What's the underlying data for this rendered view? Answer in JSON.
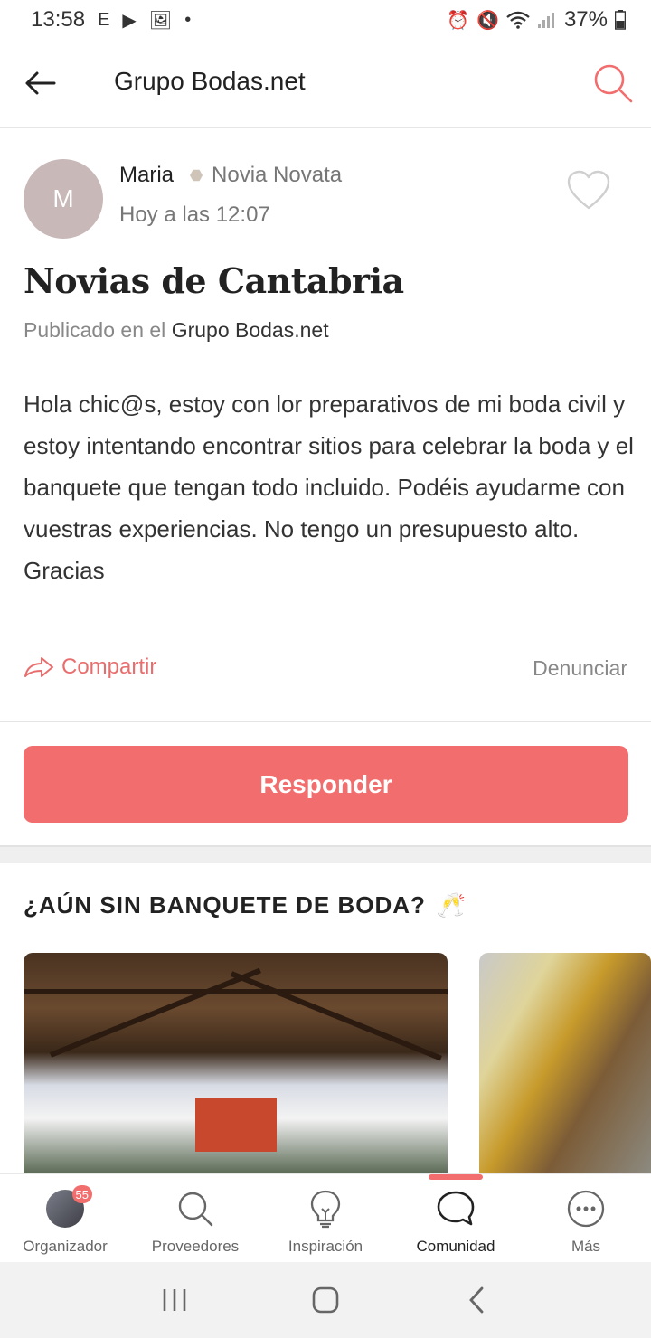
{
  "status_bar": {
    "time": "13:58",
    "left_icons": [
      "E",
      "▶",
      "🖼",
      "•"
    ],
    "battery": "37%"
  },
  "header": {
    "title": "Grupo Bodas.net"
  },
  "post": {
    "avatar_initial": "M",
    "author": "Maria",
    "rank": "Novia Novata",
    "time": "Hoy a las 12:07",
    "title": "Novias de Cantabria",
    "published_prefix": "Publicado en el",
    "published_group": "Grupo Bodas.net",
    "body": "Hola chic@s, estoy con lor preparativos de mi boda civil y estoy intentando encontrar sitios para celebrar la boda y el banquete que tengan todo incluido. Podéis ayudarme con vuestras experiencias. No tengo un presupuesto alto. Gracias",
    "share_label": "Compartir",
    "report_label": "Denunciar"
  },
  "reply_button": "Responder",
  "promo": {
    "title": "¿AÚN SIN BANQUETE DE BODA?",
    "emoji": "🥂"
  },
  "bottom_nav": {
    "items": [
      {
        "label": "Organizador",
        "badge": "55"
      },
      {
        "label": "Proveedores"
      },
      {
        "label": "Inspiración"
      },
      {
        "label": "Comunidad",
        "active": true
      },
      {
        "label": "Más"
      }
    ]
  },
  "colors": {
    "accent": "#f26d6d",
    "avatar_bg": "#c9b8b8",
    "muted_text": "#888888"
  }
}
